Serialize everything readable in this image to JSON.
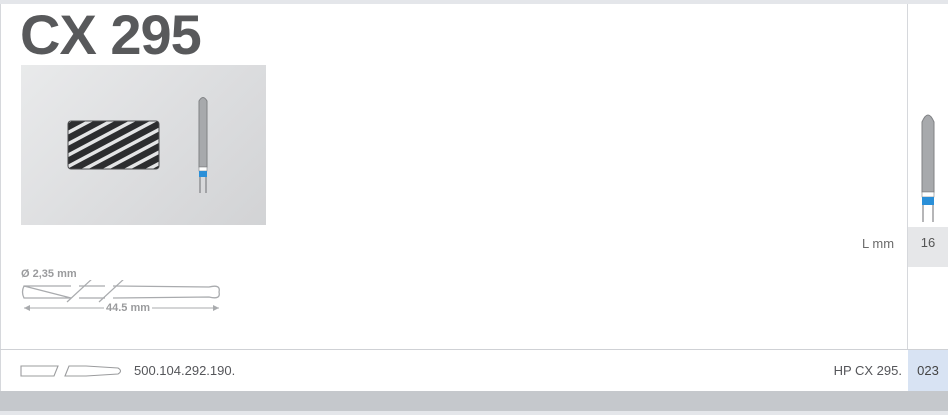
{
  "product": {
    "title": "CX 295",
    "length_label": "L mm",
    "length_value": "16",
    "order_number": "500.104.292.190.",
    "reference": "HP CX 295.",
    "pack_value": "023"
  },
  "shank": {
    "diameter_label": "Ø 2,35 mm",
    "length_label": "44.5 mm"
  },
  "colors": {
    "band_blue": "#2a8fd8",
    "title_gray": "#58595b",
    "pack_cell_bg": "#d8e3f3",
    "length_cell_bg": "#e6e7e9"
  }
}
